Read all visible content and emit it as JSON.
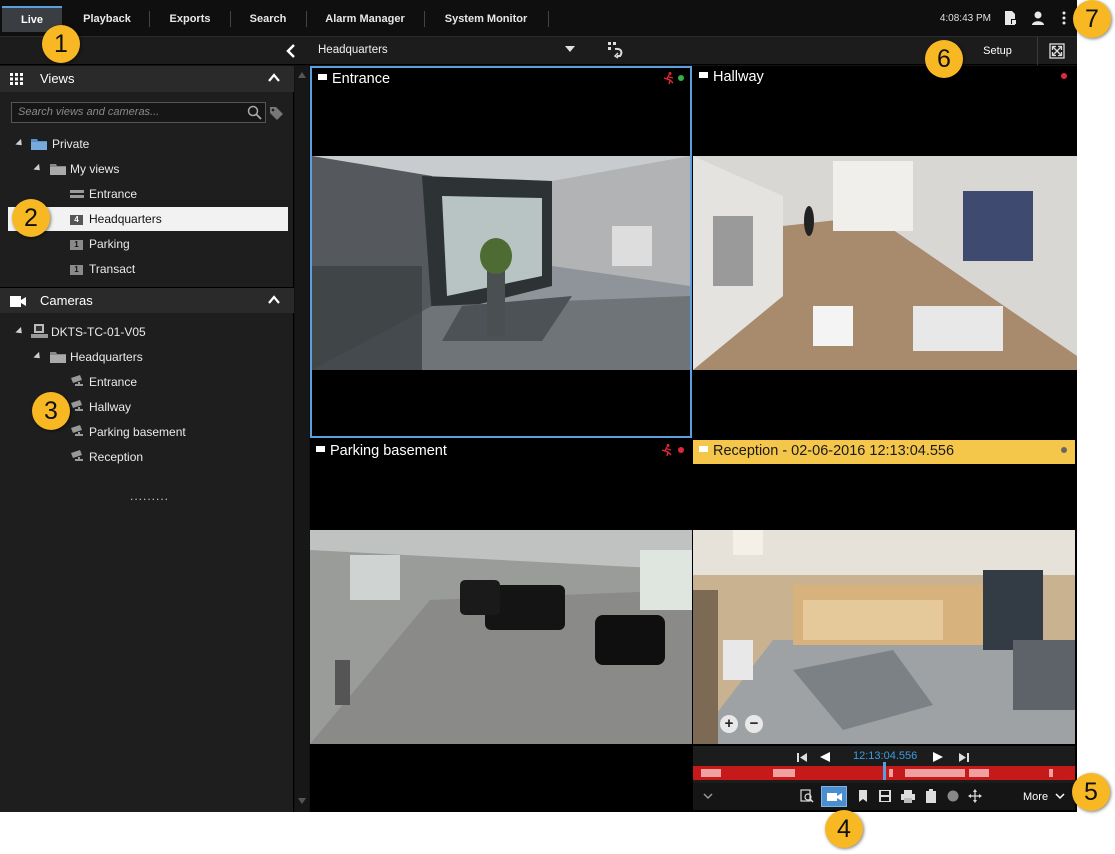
{
  "top_tabs": [
    "Live",
    "Playback",
    "Exports",
    "Search",
    "Alarm Manager",
    "System Monitor"
  ],
  "clock": "4:08:43 PM",
  "view_selector": "Headquarters",
  "setup_label": "Setup",
  "sidebar": {
    "views_title": "Views",
    "search_placeholder": "Search views and cameras...",
    "views_tree": {
      "private": "Private",
      "my_views": "My views",
      "items": [
        {
          "badge": "",
          "label": "Entrance"
        },
        {
          "badge": "4",
          "label": "Headquarters"
        },
        {
          "badge": "1",
          "label": "Parking"
        },
        {
          "badge": "1",
          "label": "Transact"
        }
      ]
    },
    "cameras_title": "Cameras",
    "cameras_tree": {
      "server": "DKTS-TC-01-V05",
      "group": "Headquarters",
      "items": [
        "Entrance",
        "Hallway",
        "Parking basement",
        "Reception"
      ]
    }
  },
  "tiles": [
    {
      "title": "Entrance"
    },
    {
      "title": "Hallway"
    },
    {
      "title": "Parking basement"
    },
    {
      "title": "Reception - 02-06-2016 12:13:04.556"
    }
  ],
  "playback": {
    "time": "12:13:04.556",
    "more_label": "More",
    "timeline_position": 0.5
  },
  "callouts": [
    "1",
    "2",
    "3",
    "4",
    "5",
    "6",
    "7"
  ],
  "colors": {
    "accent": "#5aa0e0",
    "reception_bar": "#f4c64a",
    "timeline_red": "#c61a1a",
    "recording_red": "#e0283c",
    "motion_red": "#e0283c",
    "live_green": "#2fb34a",
    "callout": "#f7b824"
  }
}
